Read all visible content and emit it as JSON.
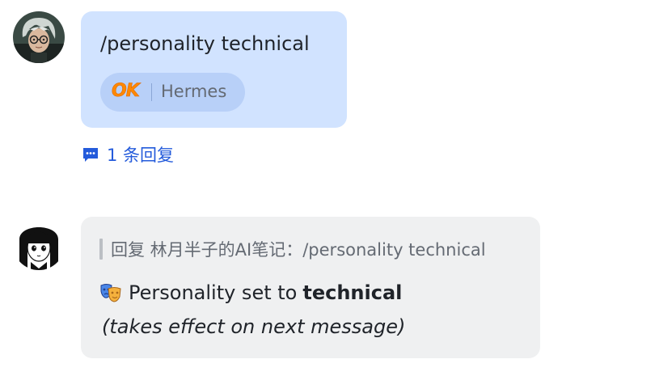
{
  "messages": [
    {
      "sender_avatar": "user-avatar-glasses",
      "text": "/personality technical",
      "bot_tag": {
        "logo": "OK",
        "name": "Hermes"
      },
      "reply_count_label": "1 条回复",
      "reply_icon": "comment-icon"
    },
    {
      "sender_avatar": "bot-avatar-manga-girl",
      "quote": "回复 林月半子的AI笔记：/personality technical",
      "line1_emoji_icon": "performing-arts-mask-icon",
      "line1_prefix": "Personality set to",
      "line1_bold": "technical",
      "line2": "(takes effect on next message)"
    }
  ],
  "colors": {
    "sent_bubble": "#d1e3ff",
    "received_bubble": "#eff0f1",
    "link": "#245bdb",
    "ok_logo": "#ff8800"
  }
}
